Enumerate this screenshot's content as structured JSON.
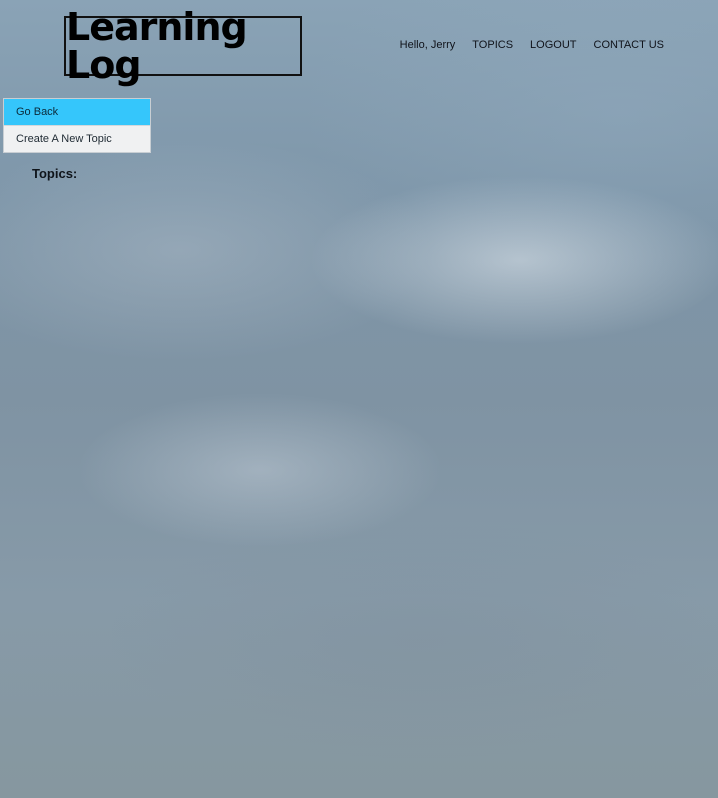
{
  "site": {
    "logo_text": "Learning Log"
  },
  "nav": {
    "greeting": "Hello, Jerry",
    "topics": "TOPICS",
    "logout": "LOGOUT",
    "contact": "CONTACT US"
  },
  "side_menu": {
    "items": [
      {
        "label": "Go Back",
        "active": true
      },
      {
        "label": "Create A New Topic",
        "active": false
      }
    ]
  },
  "main": {
    "topics_heading": "Topics:"
  },
  "colors": {
    "active_menu_bg": "#35c6fb",
    "menu_bg": "#f0f1f2"
  }
}
